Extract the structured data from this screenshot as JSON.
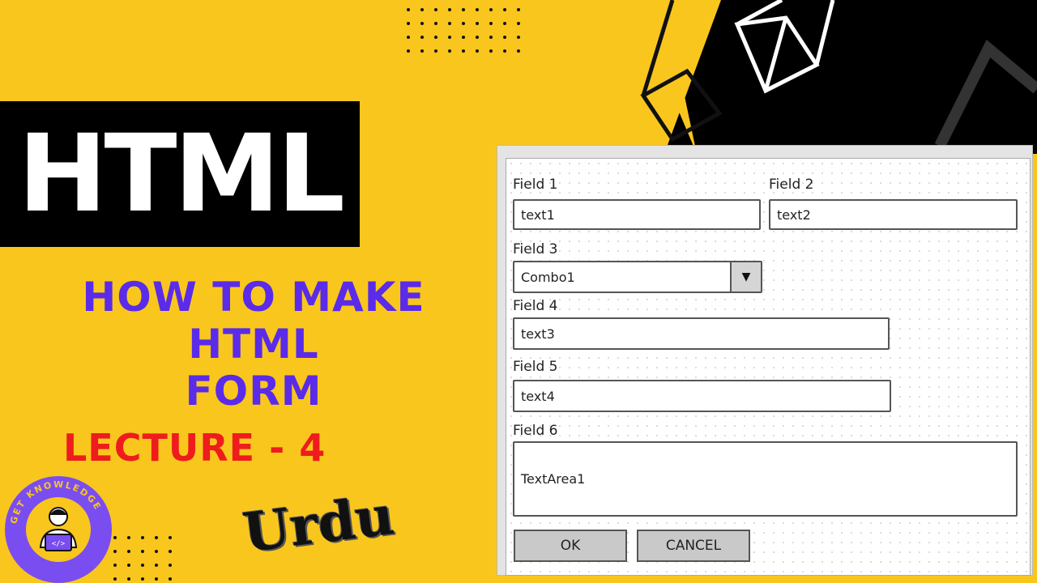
{
  "thumbnail": {
    "title": "HTML",
    "subtitle_line1": "How to make HTML",
    "subtitle_line2": "Form",
    "lecture": "LECTURE - 4",
    "language": "Urdu",
    "badge_text": "GET KNOWLEDGE",
    "badge_icon": "coder-laptop-icon"
  },
  "colors": {
    "background": "#f9c61e",
    "title_bar": "#000000",
    "subtitle": "#5a2be8",
    "lecture": "#ee1c1c",
    "badge": "#7a4df0"
  },
  "form": {
    "fields": [
      {
        "label": "Field 1",
        "value": "text1"
      },
      {
        "label": "Field 2",
        "value": "text2"
      },
      {
        "label": "Field 3",
        "value": "Combo1"
      },
      {
        "label": "Field 4",
        "value": "text3"
      },
      {
        "label": "Field 5",
        "value": "text4"
      },
      {
        "label": "Field 6",
        "value": "TextArea1"
      }
    ],
    "combo_arrow": "▼",
    "ok_label": "OK",
    "cancel_label": "CANCEL"
  }
}
